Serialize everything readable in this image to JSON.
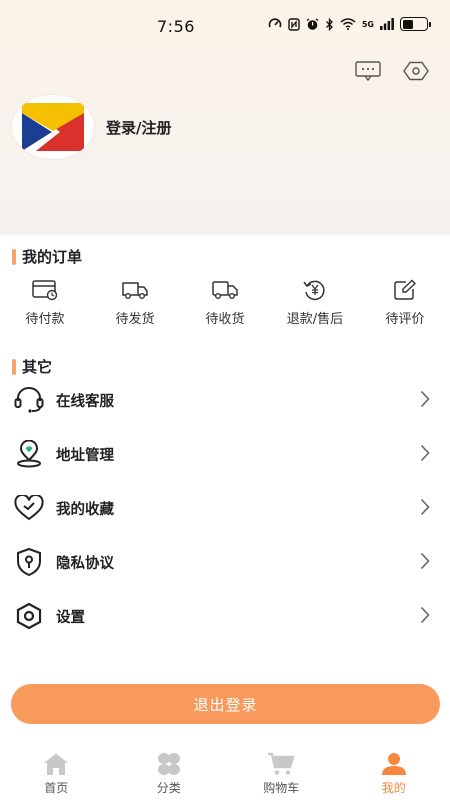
{
  "status_bar": {
    "time": "7:56",
    "signal_label": "5G"
  },
  "profile": {
    "login_label": "登录/注册"
  },
  "orders_section": {
    "title": "我的订单",
    "items": [
      {
        "label": "待付款",
        "icon": "wallet-icon"
      },
      {
        "label": "待发货",
        "icon": "truck-icon"
      },
      {
        "label": "待收货",
        "icon": "delivery-truck-icon"
      },
      {
        "label": "退款/售后",
        "icon": "refund-yen-icon"
      },
      {
        "label": "待评价",
        "icon": "edit-note-icon"
      }
    ]
  },
  "other_section": {
    "title": "其它",
    "items": [
      {
        "label": "在线客服",
        "icon": "headset-icon"
      },
      {
        "label": "地址管理",
        "icon": "location-pin-icon"
      },
      {
        "label": "我的收藏",
        "icon": "heart-icon"
      },
      {
        "label": "隐私协议",
        "icon": "shield-lock-icon"
      },
      {
        "label": "设置",
        "icon": "hexagon-settings-icon"
      }
    ]
  },
  "logout_label": "退出登录",
  "tabbar": {
    "items": [
      {
        "label": "首页",
        "icon": "home-icon"
      },
      {
        "label": "分类",
        "icon": "category-icon"
      },
      {
        "label": "购物车",
        "icon": "cart-icon"
      },
      {
        "label": "我的",
        "icon": "user-icon"
      }
    ],
    "active_index": 3
  },
  "colors": {
    "accent": "#f79a5c",
    "tab_active": "#f5873e",
    "section_bar": "#f5a46a"
  }
}
